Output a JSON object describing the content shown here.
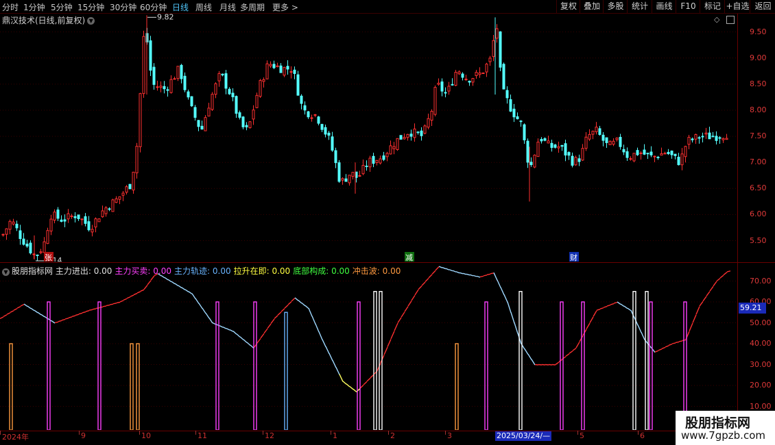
{
  "toolbar": {
    "periods": [
      "分时",
      "1分钟",
      "5分钟",
      "15分钟",
      "30分钟",
      "60分钟",
      "日线",
      "周线",
      "月线",
      "多周期",
      "更多 >"
    ],
    "active_period": "日线",
    "buttons": [
      "复权",
      "叠加",
      "多股",
      "统计",
      "画线",
      "F10",
      "标记",
      "+自选",
      "返回"
    ]
  },
  "main_chart": {
    "title": "鼎汉技术(日线,前复权)",
    "title_dropdown_icon": "chevron-down-icon",
    "corner_icons": [
      "diamond-icon",
      "window-icon"
    ],
    "high_label": "9.82",
    "low_label": "5.14",
    "price_ticks": [
      "9.50",
      "9.00",
      "8.50",
      "8.00",
      "7.50",
      "7.00",
      "6.50",
      "6.00",
      "5.50"
    ],
    "price_range": [
      5.1,
      9.85
    ],
    "markers": [
      "张",
      "减",
      "财"
    ],
    "colors": {
      "up": "#ff3030",
      "down": "#54ffff"
    }
  },
  "indicator": {
    "name": "股朋指标网",
    "items": [
      {
        "label": "主力进出:",
        "value": "0.00",
        "color": "#e0e0e0"
      },
      {
        "label": "主力买卖:",
        "value": "0.00",
        "color": "#ff40ff"
      },
      {
        "label": "主力轨迹:",
        "value": "0.00",
        "color": "#69b4ff"
      },
      {
        "label": "拉升在即:",
        "value": "0.00",
        "color": "#ffff40"
      },
      {
        "label": "底部构成:",
        "value": "0.00",
        "color": "#40ff40"
      },
      {
        "label": "冲击波:",
        "value": "0.00",
        "color": "#ff9a40"
      }
    ],
    "ticks": [
      "70.00",
      "60.00",
      "50.00",
      "40.00",
      "30.00",
      "20.00",
      "10.00"
    ],
    "current_value": "59.21",
    "range": [
      0,
      80
    ]
  },
  "date_axis": {
    "labels": [
      "2024年",
      "9",
      "10",
      "11",
      "12",
      "1",
      "2",
      "3",
      "5",
      "6"
    ],
    "highlight": "2025/03/24/—"
  },
  "watermark": {
    "title": "股朋指标网",
    "url": "www.7gpzb.com"
  }
}
